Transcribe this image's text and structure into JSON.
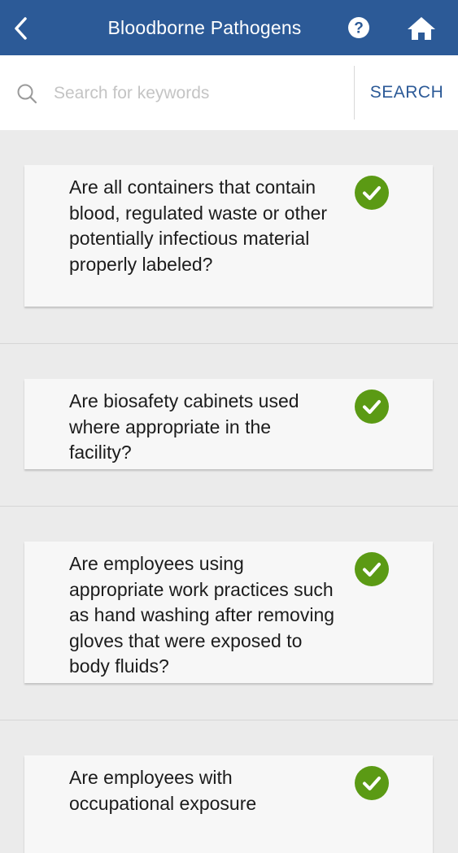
{
  "header": {
    "title": "Bloodborne Pathogens",
    "back_icon": "chevron-left-icon",
    "help_icon": "question-circle-icon",
    "home_icon": "home-icon",
    "bg_color": "#2c5a97"
  },
  "search": {
    "placeholder": "Search for keywords",
    "value": "",
    "button_label": "SEARCH"
  },
  "items": [
    {
      "question": "Are all containers that contain blood, regulated waste or other potentially infectious material properly labeled?",
      "status": "checked"
    },
    {
      "question": "Are biosafety cabinets used where appropriate in the facility?",
      "status": "checked"
    },
    {
      "question": "Are employees using appropriate work practices such as hand washing after removing gloves that were exposed to body fluids?",
      "status": "checked"
    },
    {
      "question": "Are employees with occupational exposure",
      "status": "checked"
    }
  ],
  "colors": {
    "check_green": "#5b9a14",
    "accent": "#2c5a97"
  }
}
